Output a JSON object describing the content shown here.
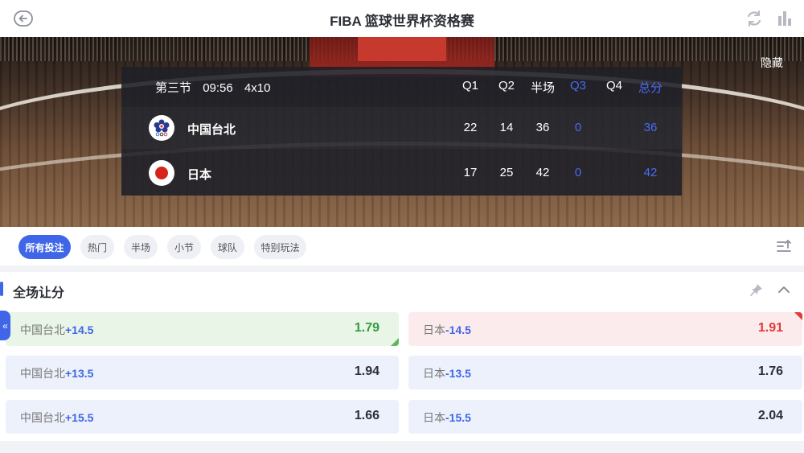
{
  "header": {
    "title": "FIBA 篮球世界杯资格赛",
    "back_icon": "arrow-left-circle-icon",
    "refresh_icon": "refresh-icon",
    "stats_icon": "bar-chart-icon"
  },
  "hero": {
    "hide_label": "隐藏",
    "scoreboard": {
      "period": "第三节",
      "clock": "09:56",
      "format": "4x10",
      "columns": [
        "Q1",
        "Q2",
        "半场",
        "Q3",
        "Q4",
        "总分"
      ],
      "teams": [
        {
          "name": "中国台北",
          "logo": "chinese-taipei-olympic-flag-icon",
          "scores": [
            "22",
            "14",
            "36",
            "0",
            "",
            "36"
          ]
        },
        {
          "name": "日本",
          "logo": "japan-flag-icon",
          "scores": [
            "17",
            "25",
            "42",
            "0",
            "",
            "42"
          ]
        }
      ]
    }
  },
  "filters": {
    "chips": [
      "所有投注",
      "热门",
      "半场",
      "小节",
      "球队",
      "特别玩法"
    ],
    "active_index": 0,
    "sort_icon": "sort-upload-icon"
  },
  "market": {
    "title": "全场让分",
    "pin_icon": "pin-icon",
    "collapse_icon": "chevron-up-icon",
    "side_tab": "«",
    "rows": [
      {
        "left": {
          "team": "中国台北",
          "handicap": "+14.5",
          "odds": "1.79",
          "state": "up"
        },
        "right": {
          "team": "日本",
          "handicap": "-14.5",
          "odds": "1.91",
          "state": "down"
        }
      },
      {
        "left": {
          "team": "中国台北",
          "handicap": "+13.5",
          "odds": "1.94",
          "state": "normal"
        },
        "right": {
          "team": "日本",
          "handicap": "-13.5",
          "odds": "1.76",
          "state": "normal"
        }
      },
      {
        "left": {
          "team": "中国台北",
          "handicap": "+15.5",
          "odds": "1.66",
          "state": "normal"
        },
        "right": {
          "team": "日本",
          "handicap": "-15.5",
          "odds": "2.04",
          "state": "normal"
        }
      }
    ]
  },
  "colors": {
    "accent": "#3f66e8",
    "odds_up": "#2f9e3f",
    "odds_down": "#e03a3a"
  }
}
